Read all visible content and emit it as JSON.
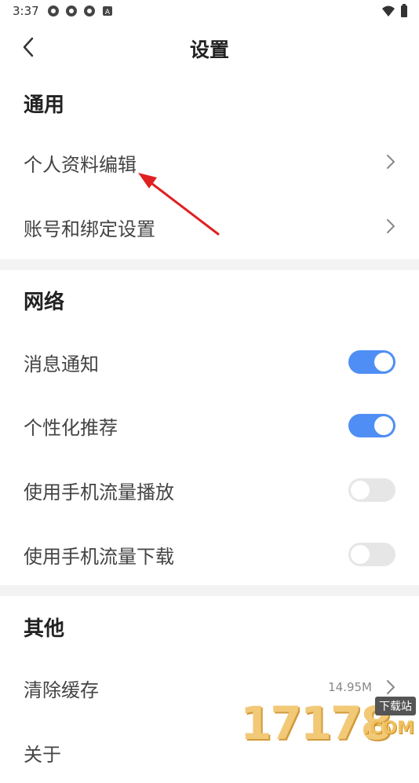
{
  "status_bar": {
    "time": "3:37",
    "notification_icons": [
      "app-icon",
      "app-icon",
      "app-icon",
      "a-icon"
    ],
    "right_icons": [
      "wifi-icon",
      "battery-icon"
    ]
  },
  "header": {
    "title": "设置",
    "back_icon": "chevron-left-icon"
  },
  "sections": {
    "general": {
      "title": "通用",
      "items": [
        {
          "label": "个人资料编辑",
          "type": "link"
        },
        {
          "label": "账号和绑定设置",
          "type": "link"
        }
      ]
    },
    "network": {
      "title": "网络",
      "items": [
        {
          "label": "消息通知",
          "type": "toggle",
          "on": true
        },
        {
          "label": "个性化推荐",
          "type": "toggle",
          "on": true
        },
        {
          "label": "使用手机流量播放",
          "type": "toggle",
          "on": false
        },
        {
          "label": "使用手机流量下载",
          "type": "toggle",
          "on": false
        }
      ]
    },
    "other": {
      "title": "其他",
      "items": [
        {
          "label": "清除缓存",
          "type": "link",
          "value": "14.95M"
        },
        {
          "label": "关于",
          "type": "link"
        }
      ]
    }
  },
  "colors": {
    "toggle_on": "#4f8ef5",
    "toggle_off": "#e6e6e6",
    "annotation_arrow": "#e02020"
  },
  "watermark": {
    "number": "17178",
    "tag": "下载站",
    "suffix": ".COM"
  }
}
